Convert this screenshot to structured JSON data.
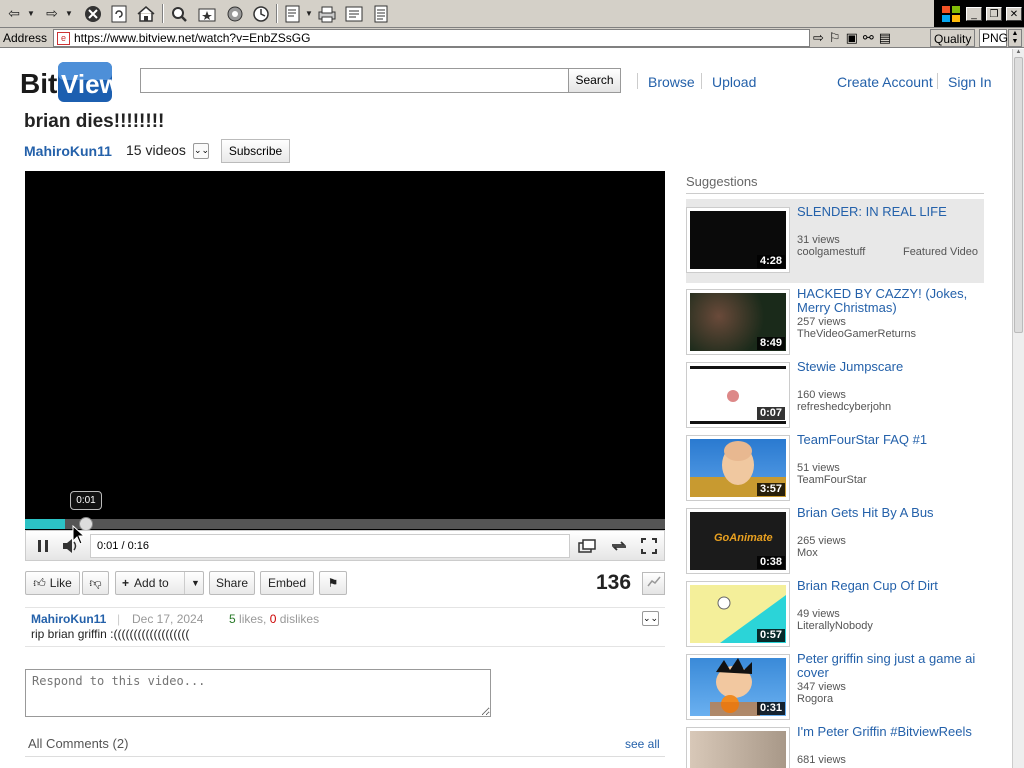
{
  "browser": {
    "address_label": "Address",
    "url": "https://www.bitview.net/watch?v=EnbZSsGG",
    "quality_label": "Quality",
    "format": "PNG"
  },
  "site": {
    "search_button": "Search",
    "nav": {
      "browse": "Browse",
      "upload": "Upload",
      "create_account": "Create Account",
      "sign_in": "Sign In"
    },
    "brand_colors": {
      "logo_blue": "#1c5fb0",
      "logo_dark": "#1a1a1a",
      "link": "#2461aa",
      "progress": "#2cc2c5"
    }
  },
  "video": {
    "title": "brian dies!!!!!!!!",
    "channel": "MahiroKun11",
    "channel_videos": "15 videos",
    "subscribe": "Subscribe",
    "tooltip_time": "0:01",
    "time_display": "0:01 / 0:16",
    "progress_fraction": 0.0625,
    "views": "136"
  },
  "actions": {
    "like": "Like",
    "add_to": "Add to",
    "share": "Share",
    "embed": "Embed"
  },
  "description": {
    "author": "MahiroKun11",
    "date": "Dec 17, 2024",
    "likes_count": "5",
    "likes_word": "likes,",
    "dislikes_count": "0",
    "dislikes_word": "dislikes",
    "text": "rip brian griffin :((((((((((((((((((("
  },
  "comments": {
    "placeholder": "Respond to this video...",
    "title": "All Comments (2)",
    "see_all": "see all"
  },
  "suggestions": {
    "title": "Suggestions",
    "items": [
      {
        "title": "SLENDER: IN REAL LIFE",
        "views": "31 views",
        "user": "coolgamestuff",
        "duration": "4:28",
        "featured": "Featured Video"
      },
      {
        "title": "HACKED BY CAZZY! (Jokes, Merry Christmas)",
        "views": "257 views",
        "user": "TheVideoGamerReturns",
        "duration": "8:49"
      },
      {
        "title": "Stewie Jumpscare",
        "views": "160 views",
        "user": "refreshedcyberjohn",
        "duration": "0:07"
      },
      {
        "title": "TeamFourStar FAQ #1",
        "views": "51 views",
        "user": "TeamFourStar",
        "duration": "3:57"
      },
      {
        "title": "Brian Gets Hit By A Bus",
        "views": "265 views",
        "user": "Mox",
        "duration": "0:38",
        "thumb_text": "GoAnimate"
      },
      {
        "title": "Brian Regan Cup Of Dirt",
        "views": "49 views",
        "user": "LiterallyNobody",
        "duration": "0:57"
      },
      {
        "title": "Peter griffin sing just a game ai cover",
        "views": "347 views",
        "user": "Rogora",
        "duration": "0:31"
      },
      {
        "title": "I'm Peter Griffin #BitviewReels",
        "views": "681 views"
      }
    ]
  }
}
